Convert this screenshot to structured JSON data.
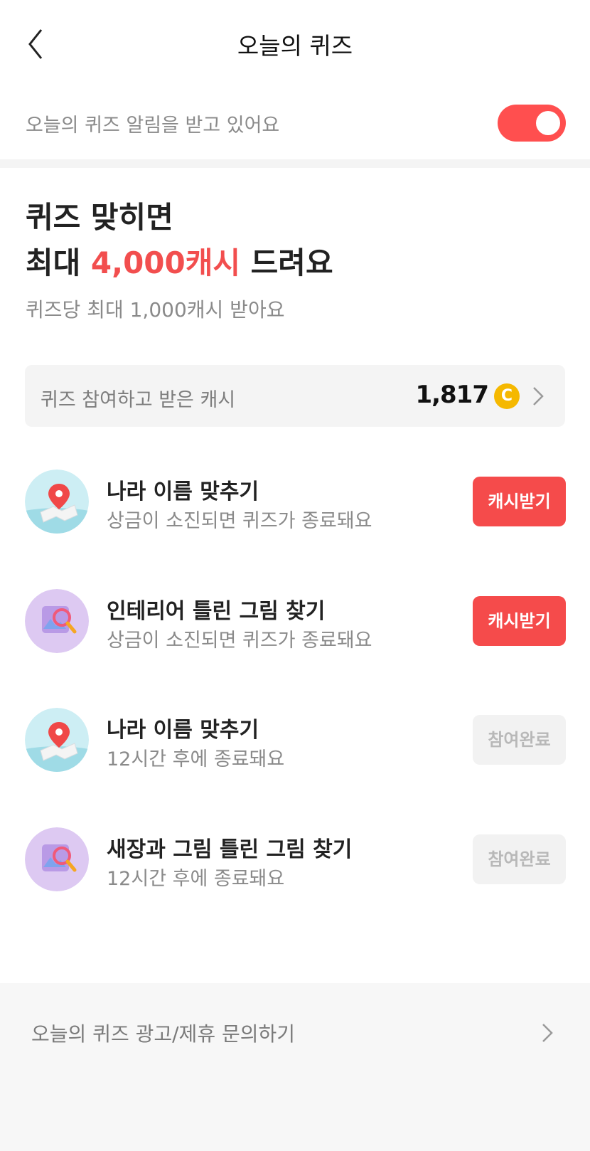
{
  "header": {
    "title": "오늘의 퀴즈",
    "back_icon": "chevron-left-icon"
  },
  "notification": {
    "label": "오늘의 퀴즈 알림을 받고 있어요",
    "enabled": true,
    "color": "#ff4f4f"
  },
  "hero": {
    "line1": "퀴즈 맞히면",
    "line2_prefix": "최대 ",
    "line2_accent": "4,000캐시",
    "line2_suffix": " 드려요",
    "subtitle": "퀴즈당 최대 1,000캐시 받아요",
    "accent_color": "#f24e4e"
  },
  "cash_summary": {
    "label": "퀴즈 참여하고 받은 캐시",
    "value": "1,817",
    "coin_icon": "coin-icon",
    "coin_symbol": "C"
  },
  "quizzes": [
    {
      "icon": "map-pin-icon",
      "title": "나라 이름 맞추기",
      "subtitle": "상금이 소진되면 퀴즈가 종료돼요",
      "button": "캐시받기",
      "status": "active"
    },
    {
      "icon": "magnifier-picture-icon",
      "title": "인테리어 틀린 그림 찾기",
      "subtitle": "상금이 소진되면 퀴즈가 종료돼요",
      "button": "캐시받기",
      "status": "active"
    },
    {
      "icon": "map-pin-icon",
      "title": "나라 이름 맞추기",
      "subtitle": "12시간 후에 종료돼요",
      "button": "참여완료",
      "status": "done"
    },
    {
      "icon": "magnifier-picture-icon",
      "title": "새장과 그림 틀린 그림 찾기",
      "subtitle": "12시간 후에 종료돼요",
      "button": "참여완료",
      "status": "done"
    }
  ],
  "footer": {
    "label": "오늘의 퀴즈 광고/제휴 문의하기"
  },
  "colors": {
    "primary_button": "#f54b4b",
    "done_button": "#f2f2f2"
  }
}
